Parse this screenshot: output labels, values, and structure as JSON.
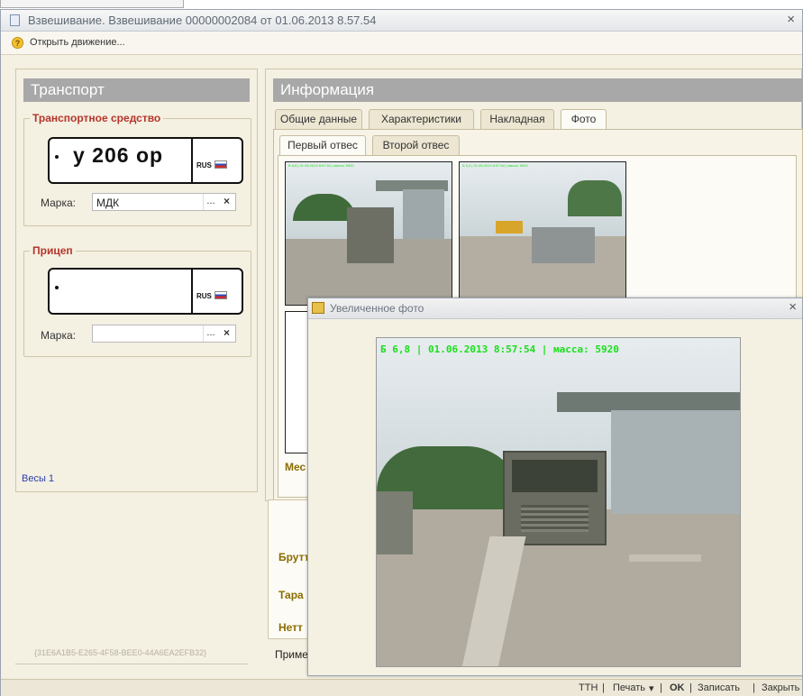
{
  "window": {
    "title": "Взвешивание. Взвешивание 00000002084 от 01.06.2013 8.57.54",
    "close": "×"
  },
  "toolbar": {
    "help": "?",
    "open_movement": "Открыть движение..."
  },
  "left": {
    "header": "Транспорт",
    "vehicle": {
      "group_label": "Транспортное средство",
      "plate_number": "у 206 ор",
      "plate_country": "RUS",
      "brand_label": "Марка:",
      "brand_value": "МДК",
      "select": "...",
      "clear": "×"
    },
    "trailer": {
      "group_label": "Прицеп",
      "plate_number": "",
      "plate_country": "RUS",
      "brand_label": "Марка:",
      "brand_value": "",
      "select": "...",
      "clear": "×"
    },
    "scales_link": "Весы 1",
    "guid": "{31E6A1B5-E265-4F58-BEE0-44A6EA2EFB32}"
  },
  "right": {
    "header": "Информация",
    "tabs": [
      "Общие данные",
      "Характеристики",
      "Накладная",
      "Фото"
    ],
    "active_tab": "Фото",
    "subtabs": [
      "Первый отвес",
      "Второй отвес"
    ],
    "active_subtab": "Первый отвес",
    "thumb_overlay_1": "Б 6,8 | 01.06.2013 8:57:54 | масса: 5920",
    "thumb_overlay_2": "Б 0,4 | 01.06.2013 8:57:54 | масса: 5920",
    "partial_label": "Мес",
    "weights": [
      "Брутт",
      "Тара",
      "Нетт"
    ],
    "note": "Приме"
  },
  "status_bar": {
    "ttn": "ТТН",
    "print": "Печать",
    "print_arrow": "▾",
    "ok": "OK",
    "save": "Записать",
    "close": "Закрыть"
  },
  "dialog": {
    "title": "Увеличенное фото",
    "close": "×",
    "overlay": "Б 6,8 | 01.06.2013 8:57:54 | масса: 5920"
  },
  "colors": {
    "header_gray": "#a8a8a8",
    "group_red": "#b5352b",
    "overlay_green": "#18e018",
    "form_bg": "#f4f0e2",
    "link_blue": "#2a3da8"
  }
}
